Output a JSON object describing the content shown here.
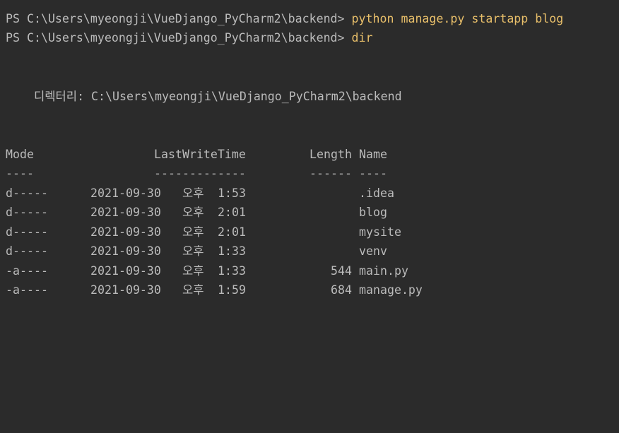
{
  "prompt": "PS C:\\Users\\myeongji\\VueDjango_PyCharm2\\backend> ",
  "commands": [
    "python manage.py startapp blog",
    "dir"
  ],
  "directory_line": "디렉터리: C:\\Users\\myeongji\\VueDjango_PyCharm2\\backend",
  "table": {
    "headers": {
      "mode": "Mode",
      "lastwritetime": "LastWriteTime",
      "length": "Length",
      "name": "Name"
    },
    "underlines": {
      "mode": "----",
      "lastwritetime": "-------------",
      "length": "------",
      "name": "----"
    },
    "rows": [
      {
        "mode": "d-----",
        "date": "2021-09-30",
        "ampm": "오후",
        "time": "1:53",
        "length": "",
        "name": ".idea"
      },
      {
        "mode": "d-----",
        "date": "2021-09-30",
        "ampm": "오후",
        "time": "2:01",
        "length": "",
        "name": "blog"
      },
      {
        "mode": "d-----",
        "date": "2021-09-30",
        "ampm": "오후",
        "time": "2:01",
        "length": "",
        "name": "mysite"
      },
      {
        "mode": "d-----",
        "date": "2021-09-30",
        "ampm": "오후",
        "time": "1:33",
        "length": "",
        "name": "venv"
      },
      {
        "mode": "-a----",
        "date": "2021-09-30",
        "ampm": "오후",
        "time": "1:33",
        "length": "544",
        "name": "main.py"
      },
      {
        "mode": "-a----",
        "date": "2021-09-30",
        "ampm": "오후",
        "time": "1:59",
        "length": "684",
        "name": "manage.py"
      }
    ]
  },
  "colors": {
    "background": "#2b2b2b",
    "text": "#bbbbbb",
    "command": "#e8bf6a"
  }
}
